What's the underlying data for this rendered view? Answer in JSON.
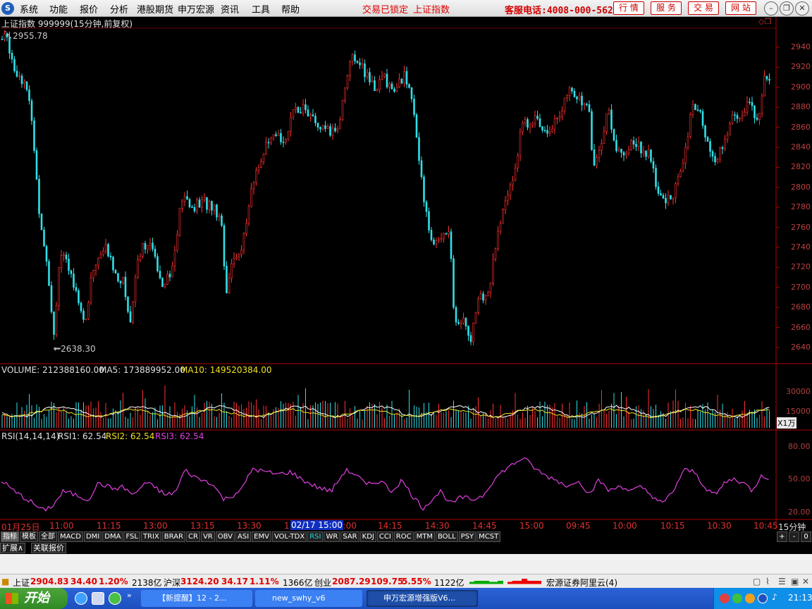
{
  "menubar": {
    "items": [
      "系统",
      "功能",
      "报价",
      "分析",
      "港股期货",
      "申万宏源",
      "资讯",
      "工具",
      "帮助"
    ],
    "status_locked": "交易已锁定",
    "status_index": "上证指数",
    "hotline": "客服电话:4008-000-562",
    "buttons": [
      "行 情",
      "服 务",
      "交 易",
      "网 站"
    ]
  },
  "header": {
    "title": "上证指数 999999(15分钟,前复权)",
    "max_label": "2955.78",
    "min_label": "2638.30"
  },
  "price_axis": {
    "ticks": [
      "2940",
      "2920",
      "2900",
      "2880",
      "2860",
      "2840",
      "2820",
      "2800",
      "2780",
      "2760",
      "2740",
      "2720",
      "2700",
      "2680",
      "2660",
      "2640"
    ]
  },
  "volume": {
    "label": "VOLUME: 212388160.00",
    "ma5": "MA5: 173889952.00",
    "ma10": "MA10: 149520384.00",
    "ticks": [
      "30000",
      "15000"
    ],
    "unit": "X1万"
  },
  "rsi": {
    "label": "RSI(14,14,14)",
    "rsi1": "RSI1: 62.54",
    "rsi2": "RSI2: 62.54",
    "rsi3": "RSI3: 62.54",
    "ticks": [
      "80.00",
      "50.00",
      "20.00"
    ]
  },
  "time_axis": {
    "labels": [
      "01月25日",
      "11:00",
      "11:15",
      "13:00",
      "13:15",
      "13:30",
      "1",
      "4:00",
      "14:15",
      "14:30",
      "14:45",
      "15:00",
      "09:45",
      "10:00",
      "10:15",
      "10:30",
      "10:45"
    ],
    "cursor": "02/17 15:00",
    "period": "15分钟"
  },
  "tabs": [
    "指标",
    "模板",
    "全部",
    "MACD",
    "DMI",
    "DMA",
    "FSL",
    "TRIX",
    "BRAR",
    "CR",
    "VR",
    "OBV",
    "ASI",
    "EMV",
    "VOL-TDX",
    "RSI",
    "WR",
    "SAR",
    "KDJ",
    "CCI",
    "ROC",
    "MTM",
    "BOLL",
    "PSY",
    "MCST"
  ],
  "tab_controls": [
    "+",
    "-",
    "0"
  ],
  "subtabs": [
    "扩展∧",
    "关联报价"
  ],
  "statusbar": {
    "sh_name": "上证",
    "sh_value": "2904.83",
    "sh_change": "34.40",
    "sh_pct": "1.20%",
    "sh_amount": "2138亿",
    "hs_name": "沪深",
    "hs_value": "3124.20",
    "hs_change": "34.17",
    "hs_pct": "1.11%",
    "hs_amount": "1366亿",
    "cy_name": "创业",
    "cy_value": "2087.29",
    "cy_change": "109.75",
    "cy_pct": "5.55%",
    "cy_amount": "1122亿",
    "broker": "宏源证券阿里云(4)"
  },
  "taskbar": {
    "start": "开始",
    "tasks": [
      "【新提醒】12 - 2...",
      "new_swhy_v6",
      "申万宏源增强版V6..."
    ],
    "clock": "21:13"
  }
}
